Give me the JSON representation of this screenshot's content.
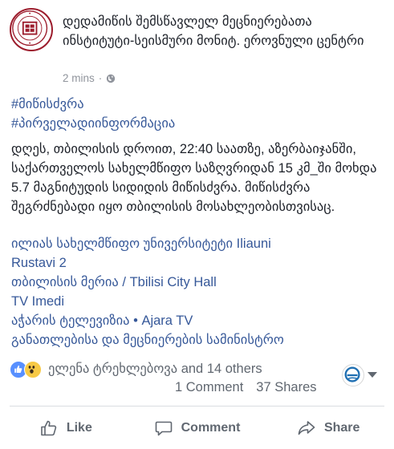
{
  "post": {
    "author": "დედამიწის შემსწავლელ მეცნიერებათა ინსტიტუტი-სეისმური მონიტ. ეროვნული ცენტრი",
    "time": "2 mins",
    "dot": "·",
    "hashtags": [
      "#მიწისძვრა",
      "#პირველადიინფორმაცია"
    ],
    "body": "დღეს, თბილისის დროით, 22:40 საათზე, აზერბაიჯანში, საქართველოს სახელმწიფო საზღვრიდან 15 კმ_ში მოხდა 5.7 მაგნიტუდის სიდიდის მიწისძვრა. მიწისძვრა შეგრძნებადი იყო თბილისის მოსახლეობისთვისაც.",
    "tags": [
      "ილიას სახელმწიფო უნივერსიტეტი Iliauni",
      "Rustavi 2",
      "თბილისის მერია / Tbilisi City Hall",
      "TV Imedi",
      "აჭარის ტელევიზია • Ajara TV",
      "განათლებისა და მეცნიერების სამინისტრო"
    ],
    "reactions_text": "ელენა ტრეხლებოვა and 14 others",
    "comments_count": "1 Comment",
    "shares_count": "37 Shares"
  },
  "actions": {
    "like": "Like",
    "comment": "Comment",
    "share": "Share"
  },
  "colors": {
    "link": "#365899",
    "meta": "#90949c",
    "action": "#606770",
    "like_reaction": "#5890ff",
    "wow_reaction": "#f7c945",
    "seal_red": "#9c1c2c"
  },
  "icons": {
    "avatar": "institute-seal-logo",
    "privacy": "globe-icon",
    "like_reaction": "like-reaction-icon",
    "wow_reaction": "wow-reaction-icon",
    "page_avatar": "page-logo-icon",
    "page_menu": "chevron-down-icon",
    "like": "thumbs-up-icon",
    "comment": "comment-bubble-icon",
    "share": "share-arrow-icon"
  }
}
